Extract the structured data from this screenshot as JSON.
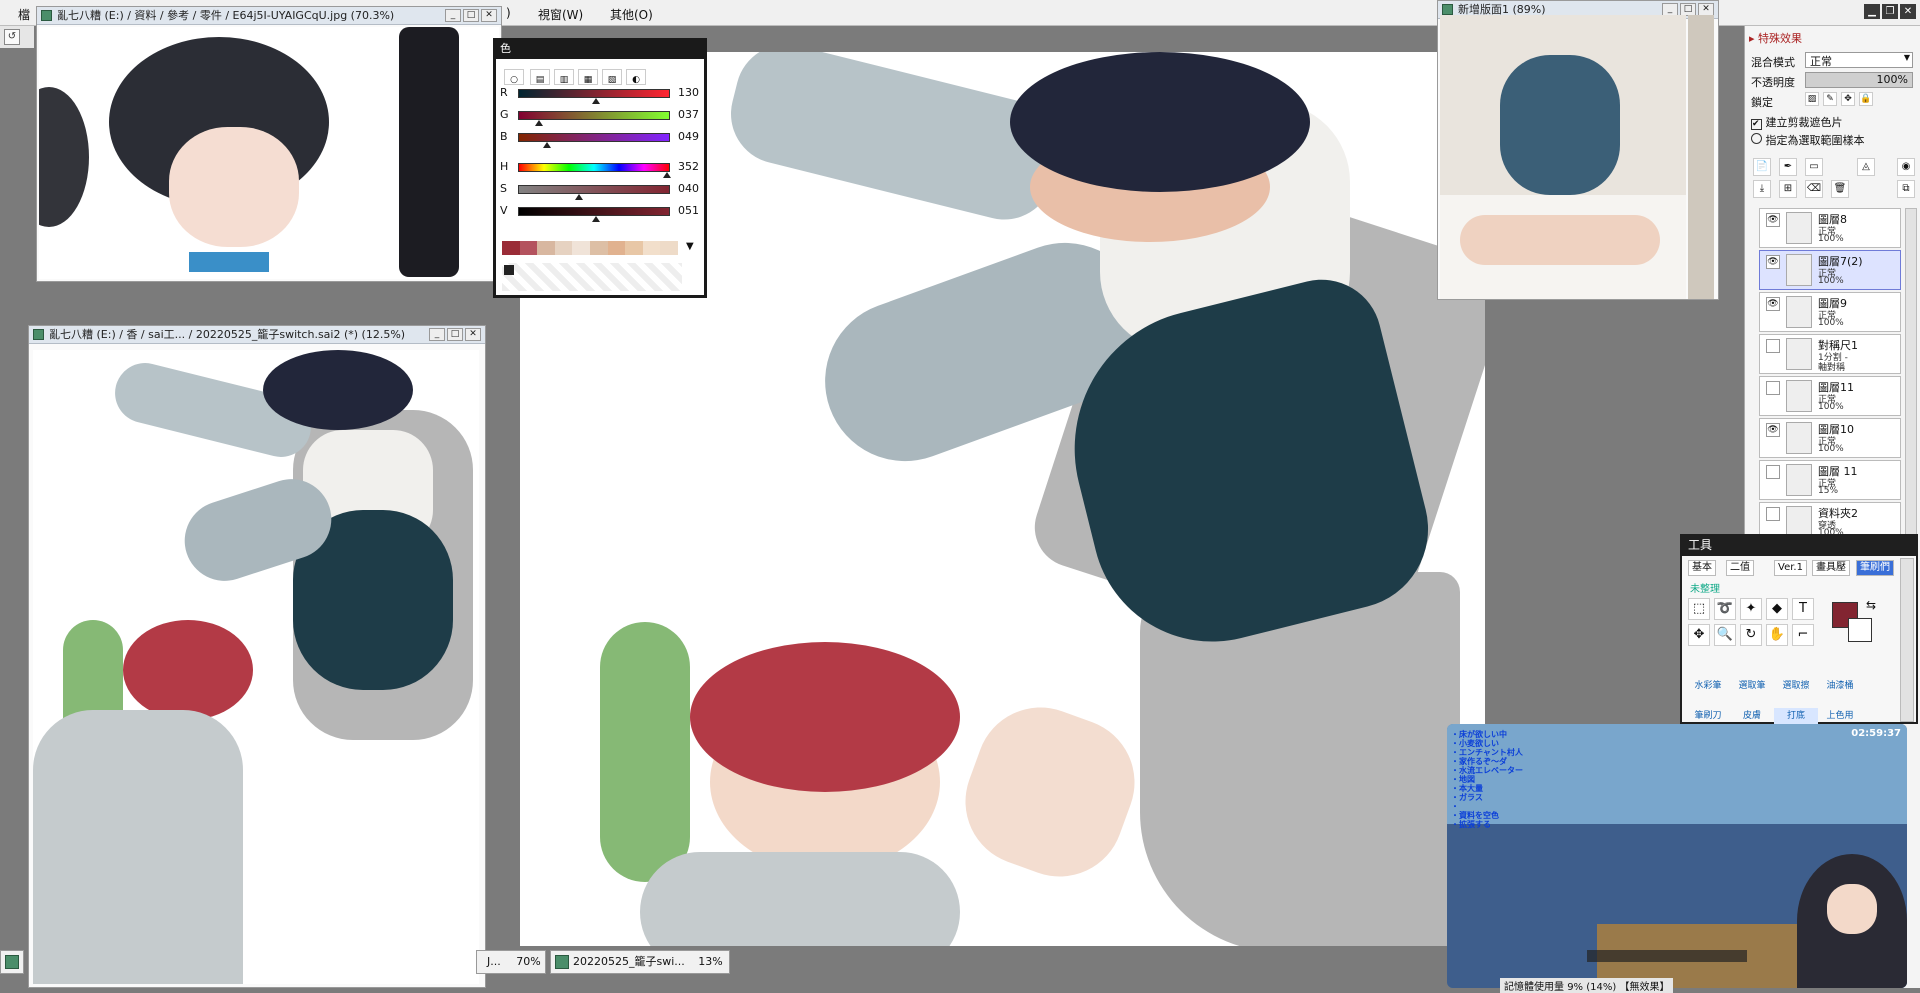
{
  "menubar": {
    "file_label": "檔",
    "view_label": "視窗(W)",
    "other_label": "其他(O)",
    "close_paren": ")"
  },
  "canvas": {
    "tab_label": "20220525_籠子swi...",
    "tab_zoom": "13%",
    "left_tab_suffix": "J...",
    "left_tab_zoom": "70%"
  },
  "ref_window": {
    "title": "亂七八糟 (E:) / 資料 / 參考 / 零件 / E64j5I-UYAIGCqU.jpg (70.3%)"
  },
  "nav_window": {
    "title": "亂七八糟 (E:) / 香 / sai工...  / 20220525_籠子switch.sai2 (*) (12.5%)"
  },
  "new_window": {
    "title": "新增版面1 (89%)"
  },
  "color_panel": {
    "title": "色",
    "rows": [
      {
        "label": "R",
        "value": "130",
        "pos": 0.51
      },
      {
        "label": "G",
        "value": "037",
        "pos": 0.14
      },
      {
        "label": "B",
        "value": "049",
        "pos": 0.19
      },
      {
        "label": "H",
        "value": "352",
        "pos": 0.98
      },
      {
        "label": "S",
        "value": "040",
        "pos": 0.4
      },
      {
        "label": "V",
        "value": "051",
        "pos": 0.51
      }
    ],
    "current_color": "#822531"
  },
  "right_panel": {
    "effects_label": "特殊效果",
    "blend_label": "混合模式",
    "blend_value": "正常",
    "opacity_label": "不透明度",
    "opacity_value": "100%",
    "lock_label": "鎖定",
    "clip_label": "建立剪裁遮色片",
    "sample_label": "指定為選取範圍樣本",
    "layers": [
      {
        "name": "圖層8",
        "mode": "正常",
        "opacity": "100%",
        "visible": true,
        "selected": false
      },
      {
        "name": "圖層7(2)",
        "mode": "正常",
        "opacity": "100%",
        "visible": true,
        "selected": true
      },
      {
        "name": "圖層9",
        "mode": "正常",
        "opacity": "100%",
        "visible": true,
        "selected": false
      },
      {
        "name": "對稱尺1",
        "mode": "1分割 -",
        "opacity": "軸對稱",
        "visible": false,
        "selected": false
      },
      {
        "name": "圖層11",
        "mode": "正常",
        "opacity": "100%",
        "visible": false,
        "selected": false
      },
      {
        "name": "圖層10",
        "mode": "正常",
        "opacity": "100%",
        "visible": true,
        "selected": false
      },
      {
        "name": "圖層 11",
        "mode": "正常",
        "opacity": "15%",
        "visible": false,
        "selected": false
      },
      {
        "name": "資料夾2",
        "mode": "穿透",
        "opacity": "100%",
        "visible": false,
        "selected": false
      }
    ]
  },
  "tool_panel": {
    "title": "工具",
    "tabs": [
      "基本",
      "二值",
      "Ver.1",
      "畫具壓",
      "筆刷們"
    ],
    "unsorted": "未整理",
    "brushes": [
      "水彩筆",
      "選取筆",
      "選取擦",
      "油漆桶"
    ],
    "brushes2": [
      "筆刷刀",
      "皮膚",
      "打底",
      "上色用"
    ],
    "text_tool": "T"
  },
  "stream": {
    "clock": "02:59:37",
    "checklist": [
      "・床が欲しい中",
      "・小麦欲しい",
      "・エンチャント村人",
      "・家作るぞ〜ダ",
      "・水流エレベーター",
      "・地図",
      "・本大量",
      "・ガラス",
      "・",
      "・資料を空色",
      "・拡張する"
    ]
  },
  "status": {
    "memory_label": "記憶體使用量",
    "memory_value": "9% (14%)",
    "hint": "【無效果】"
  }
}
